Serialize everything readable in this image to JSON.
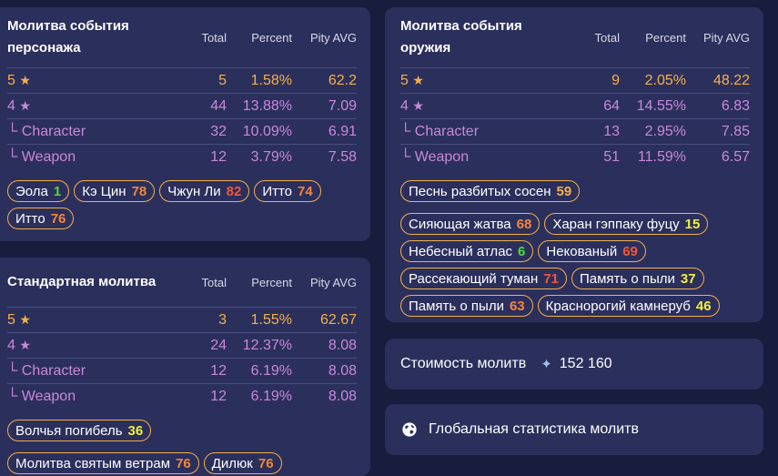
{
  "char_wish": {
    "title": "Молитва события персонажа",
    "headers": {
      "total": "Total",
      "percent": "Percent",
      "pity": "Pity AVG"
    },
    "rows": [
      {
        "label": "5",
        "star": "★",
        "total": "5",
        "percent": "1.58%",
        "pity": "62.2"
      },
      {
        "label": "4",
        "star": "★",
        "total": "44",
        "percent": "13.88%",
        "pity": "7.09"
      },
      {
        "label": "└ Character",
        "total": "32",
        "percent": "10.09%",
        "pity": "6.91"
      },
      {
        "label": "└ Weapon",
        "total": "12",
        "percent": "3.79%",
        "pity": "7.58"
      }
    ],
    "tags": [
      {
        "name": "Эола",
        "count": "1"
      },
      {
        "name": "Кэ Цин",
        "count": "78"
      },
      {
        "name": "Чжун Ли",
        "count": "82"
      },
      {
        "name": "Итто",
        "count": "74"
      },
      {
        "name": "Итто",
        "count": "76"
      }
    ]
  },
  "weapon_wish": {
    "title": "Молитва события оружия",
    "headers": {
      "total": "Total",
      "percent": "Percent",
      "pity": "Pity AVG"
    },
    "rows": [
      {
        "label": "5",
        "star": "★",
        "total": "9",
        "percent": "2.05%",
        "pity": "48.22"
      },
      {
        "label": "4",
        "star": "★",
        "total": "64",
        "percent": "14.55%",
        "pity": "6.83"
      },
      {
        "label": "└ Character",
        "total": "13",
        "percent": "2.95%",
        "pity": "7.85"
      },
      {
        "label": "└ Weapon",
        "total": "51",
        "percent": "11.59%",
        "pity": "6.57"
      }
    ],
    "tags": [
      {
        "name": "Песнь разбитых сосен",
        "count": "59"
      },
      {
        "name": "Сияющая жатва",
        "count": "68"
      },
      {
        "name": "Харан гэппаку фуцу",
        "count": "15"
      },
      {
        "name": "Небесный атлас",
        "count": "6"
      },
      {
        "name": "Некованый",
        "count": "69"
      },
      {
        "name": "Рассекающий туман",
        "count": "71"
      },
      {
        "name": "Память о пыли",
        "count": "37"
      },
      {
        "name": "Память о пыли",
        "count": "63"
      },
      {
        "name": "Краснорогий камнеруб",
        "count": "46"
      }
    ]
  },
  "standard_wish": {
    "title": "Стандартная молитва",
    "headers": {
      "total": "Total",
      "percent": "Percent",
      "pity": "Pity AVG"
    },
    "rows": [
      {
        "label": "5",
        "star": "★",
        "total": "3",
        "percent": "1.55%",
        "pity": "62.67"
      },
      {
        "label": "4",
        "star": "★",
        "total": "24",
        "percent": "12.37%",
        "pity": "8.08"
      },
      {
        "label": "└ Character",
        "total": "12",
        "percent": "6.19%",
        "pity": "8.08"
      },
      {
        "label": "└ Weapon",
        "total": "12",
        "percent": "6.19%",
        "pity": "8.08"
      }
    ],
    "tags": [
      {
        "name": "Волчья погибель",
        "count": "36"
      },
      {
        "name": "Молитва святым ветрам",
        "count": "76"
      },
      {
        "name": "Дилюк",
        "count": "76"
      }
    ]
  },
  "cost": {
    "label": "Стоимость молитв",
    "icon": "primogem-icon",
    "value": "152 160"
  },
  "global": {
    "icon": "globe-icon",
    "label": "Глобальная статистика молитв"
  },
  "colors": {
    "five_star": "#f6b04a",
    "four_star": "#c989d8",
    "count_green": "#4ddb3a",
    "count_yellow": "#f2f03a",
    "count_orange": "#f4863a",
    "count_red": "#f0573a",
    "panel_bg": "#2b2f5c",
    "page_bg": "#181c3d"
  }
}
